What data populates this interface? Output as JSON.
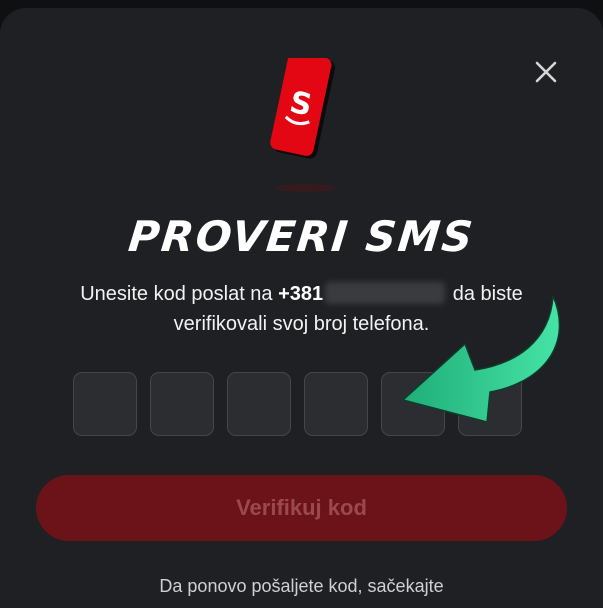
{
  "modal": {
    "title": "PROVERI SMS",
    "description_prefix": "Unesite kod poslat na",
    "phone_prefix": "+381",
    "description_suffix": "da biste verifikovali svoj broj telefona.",
    "code_digits": 6,
    "verify_button_label": "Verifikuj kod",
    "footer_text": "Da ponovo pošaljete kod, sačekajte"
  },
  "icons": {
    "close": "close-icon",
    "phone": "phone-sms-icon",
    "arrow": "arrow-pointer-icon"
  },
  "colors": {
    "accent": "#e30613",
    "button_disabled": "#6b1318",
    "arrow": "#2ecf8f"
  }
}
